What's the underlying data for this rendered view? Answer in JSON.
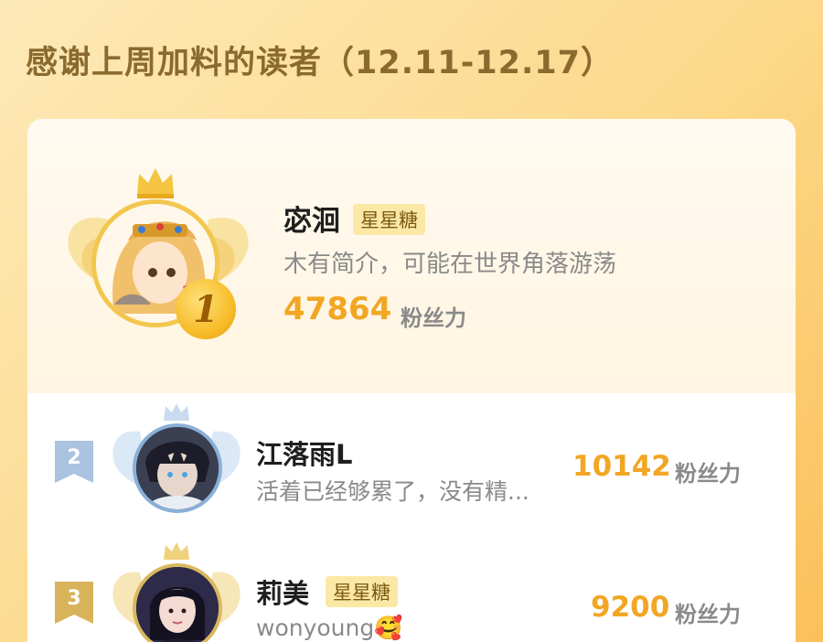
{
  "header": {
    "title": "感谢上周加料的读者（12.11-12.17）"
  },
  "ranking": [
    {
      "rank": "1",
      "name": "宓洄",
      "badge": "星星糖",
      "bio": "木有简介，可能在世界角落游荡",
      "score": "47864",
      "score_unit": "粉丝力"
    },
    {
      "rank": "2",
      "name": "江落雨L",
      "badge": "",
      "bio": "活着已经够累了，没有精...",
      "score": "10142",
      "score_unit": "粉丝力"
    },
    {
      "rank": "3",
      "name": "莉美",
      "badge": "星星糖",
      "bio": "wonyoung🥰",
      "score": "9200",
      "score_unit": "粉丝力"
    }
  ],
  "colors": {
    "accent": "#f2a623",
    "background": "#fcd98a",
    "title": "#8a6a2e",
    "silver": "#a9c3e0",
    "bronze": "#d8b35a"
  }
}
